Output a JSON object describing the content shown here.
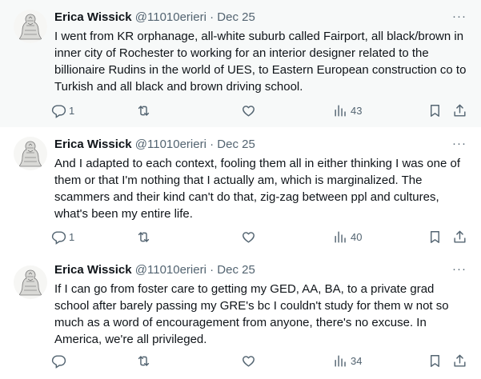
{
  "tweets": [
    {
      "author_name": "Erica Wissick",
      "handle": "@11010erieri",
      "separator": "·",
      "date": "Dec 25",
      "more": "···",
      "text": "I went from KR orphanage, all-white suburb called Fairport, all black/brown in inner city of Rochester to working for an interior designer related to the billionaire Rudins in the world of UES, to Eastern European construction co to Turkish and all black and brown driving school.",
      "reply_count": "1",
      "repost_count": "",
      "like_count": "",
      "views": "43"
    },
    {
      "author_name": "Erica Wissick",
      "handle": "@11010erieri",
      "separator": "·",
      "date": "Dec 25",
      "more": "···",
      "text": "And I adapted to each context, fooling them all in either thinking I was one of them or that I'm nothing that I actually am, which is marginalized. The scammers and their kind can't do that, zig-zag between ppl and cultures, what's been my entire life.",
      "reply_count": "1",
      "repost_count": "",
      "like_count": "",
      "views": "40"
    },
    {
      "author_name": "Erica Wissick",
      "handle": "@11010erieri",
      "separator": "·",
      "date": "Dec 25",
      "more": "···",
      "text": "If I can go from foster care to getting my GED, AA, BA, to a private grad school after barely passing my GRE's bc I couldn't study for them w not so much as a word of encouragement from anyone, there's no excuse. In America, we're all privileged.",
      "reply_count": "",
      "repost_count": "",
      "like_count": "",
      "views": "34"
    }
  ],
  "colors": {
    "text_primary": "#0f1419",
    "text_secondary": "#536471",
    "thread_line": "#cfd9de",
    "highlight_bg": "#f7f9f9"
  },
  "icons": [
    "reply-icon",
    "repost-icon",
    "like-icon",
    "views-icon",
    "bookmark-icon",
    "share-icon",
    "more-icon"
  ]
}
